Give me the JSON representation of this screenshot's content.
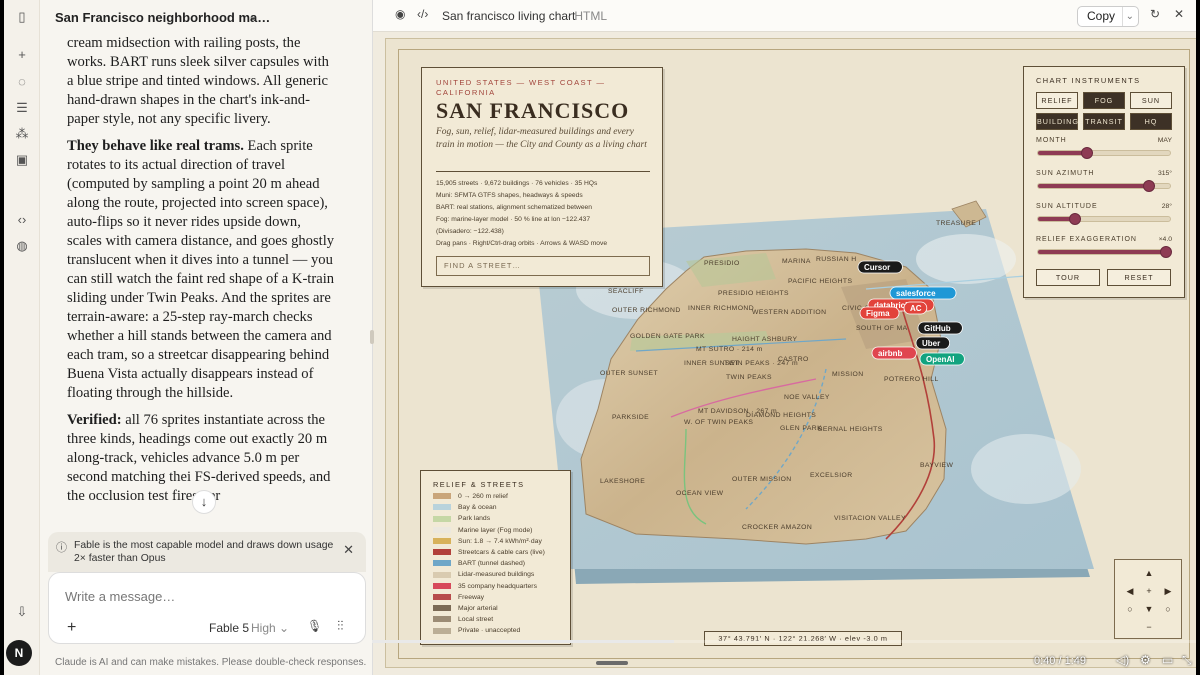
{
  "chat": {
    "title": "San Francisco neighborhood ma…",
    "message": [
      {
        "bold": "",
        "text": "cream midsection with railing posts, the works. BART runs sleek silver capsules with a blue stripe and tinted windows. All generic hand-drawn shapes in the chart's ink-and-paper style, not any specific livery."
      },
      {
        "bold": "They behave like real trams.",
        "text": " Each sprite rotates to its actual direction of travel (computed by sampling a point 20 m ahead along the route, projected into screen space), auto-flips so it never rides upside down, scales with camera distance, and goes ghostly translucent when it dives into a tunnel — you can still watch the faint red shape of a K-train sliding under Twin Peaks. And the sprites are terrain-aware: a 25-step ray-march checks whether a hill stands between the camera and each tram, so a streetcar disappearing behind Buena Vista actually disappears instead of floating through the hillside."
      },
      {
        "bold": "Verified:",
        "text": " all 76 sprites instantiate across the three kinds, headings come out exactly 20 m along-track, vehicles advance 5.0 m per second matching thei   FS-derived speeds, and the occlusion test fires per"
      }
    ],
    "notice": "Fable is the most capable model and draws down usage 2× faster than Opus",
    "composer_placeholder": "Write a message…",
    "model": "Fable 5",
    "effort": "High",
    "disclaimer": "Claude is AI and can make mistakes. Please double-check responses.",
    "avatar": "N"
  },
  "artifact": {
    "title": "San francisco living chart",
    "type": "· HTML",
    "copy": "Copy"
  },
  "poster": {
    "kicker": "UNITED STATES — WEST COAST — CALIFORNIA",
    "title": "SAN FRANCISCO",
    "subtitle": "Fog, sun, relief, lidar-measured buildings and every train in motion — the City and County as a living chart",
    "meta": [
      "15,905 streets · 9,672 buildings · 76 vehicles · 35 HQs",
      "Muni: SFMTA GTFS shapes, headways & speeds",
      "BART: real stations, alignment schematized between",
      "Fog: marine-layer model · 50 % line at lon −122.437",
      "(Divisadero: −122.438)",
      "Drag pans · Right/Ctrl-drag orbits · Arrows & WASD move"
    ],
    "find_placeholder": "FIND A STREET…",
    "coords": "37° 43.791′ N · 122° 21.268′ W · elev -3.0 m"
  },
  "instruments": {
    "title": "CHART INSTRUMENTS",
    "buttons": [
      {
        "label": "RELIEF",
        "on": false
      },
      {
        "label": "FOG",
        "on": true
      },
      {
        "label": "SUN",
        "on": false
      },
      {
        "label": "BUILDINGS",
        "on": true
      },
      {
        "label": "TRANSIT",
        "on": true
      },
      {
        "label": "HQ",
        "on": true
      }
    ],
    "sliders": [
      {
        "label": "MONTH",
        "value": "MAY",
        "fraction": 0.37
      },
      {
        "label": "SUN AZIMUTH",
        "value": "315°",
        "fraction": 0.84
      },
      {
        "label": "SUN ALTITUDE",
        "value": "28°",
        "fraction": 0.28
      },
      {
        "label": "RELIEF EXAGGERATION",
        "value": "×4.0",
        "fraction": 0.97
      }
    ],
    "tour": "TOUR",
    "reset": "RESET"
  },
  "legend": {
    "title": "RELIEF & STREETS",
    "items": [
      {
        "label": "0 → 260 m relief",
        "color": "#c9a57a"
      },
      {
        "label": "Bay & ocean",
        "color": "#b9d3dc"
      },
      {
        "label": "Park lands",
        "color": "#c5d7a5"
      },
      {
        "label": "Marine layer (Fog mode)",
        "color": "#ece8de"
      },
      {
        "label": "Sun: 1.8 → 7.4 kWh/m²·day",
        "color": "#d8b25a"
      },
      {
        "label": "Streetcars & cable cars (live)",
        "color": "#b2403a"
      },
      {
        "label": "BART (tunnel dashed)",
        "color": "#6fa7c8"
      },
      {
        "label": "Lidar-measured buildings",
        "color": "#d9cbb0"
      },
      {
        "label": "35 company headquarters",
        "color": "#d7495a"
      },
      {
        "label": "Freeway",
        "color": "#b74b4b"
      },
      {
        "label": "Major arterial",
        "color": "#7b6a55"
      },
      {
        "label": "Local street",
        "color": "#9c8c75"
      },
      {
        "label": "Private · unaccepted",
        "color": "#bbae96"
      }
    ]
  },
  "map": {
    "neighborhoods": [
      "PRESIDIO",
      "MARINA",
      "RUSSIAN H",
      "PRESIDIO HEIGHTS",
      "PACIFIC HEIGHTS",
      "SEACLIFF",
      "OUTER RICHMOND",
      "INNER RICHMOND",
      "WESTERN ADDITION",
      "CIVIC CE",
      "SOUTH OF MA",
      "GOLDEN GATE PARK",
      "HAIGHT ASHBURY",
      "MT SUTRO · 214 m",
      "INNER SUNSET",
      "TWIN PEAKS · 247 m",
      "CASTRO",
      "OUTER SUNSET",
      "TWIN PEAKS",
      "MISSION",
      "POTRERO HILL",
      "NOE VALLEY",
      "PARKSIDE",
      "MT DAVIDSON · 267 m",
      "W. OF TWIN PEAKS",
      "DIAMOND HEIGHTS",
      "GLEN PARK",
      "BERNAL HEIGHTS",
      "BAYVIEW",
      "LAKESHORE",
      "OCEAN VIEW",
      "OUTER MISSION",
      "EXCELSIOR",
      "CROCKER AMAZON",
      "VISITACION VALLEY",
      "TREASURE I"
    ],
    "hq": [
      {
        "label": "Cursor",
        "color": "#1a1a1a"
      },
      {
        "label": "salesforce",
        "color": "#1f98d6"
      },
      {
        "label": "databricks",
        "color": "#e2433b"
      },
      {
        "label": "Figma",
        "color": "#e2433b"
      },
      {
        "label": "AC",
        "color": "#e2433b"
      },
      {
        "label": "GitHub",
        "color": "#1a1a1a"
      },
      {
        "label": "Uber",
        "color": "#1a1a1a"
      },
      {
        "label": "airbnb",
        "color": "#e0454f"
      },
      {
        "label": "OpenAI",
        "color": "#12a37f"
      }
    ]
  },
  "video": {
    "time": "0:40 / 1:49",
    "progress": 0.367
  }
}
